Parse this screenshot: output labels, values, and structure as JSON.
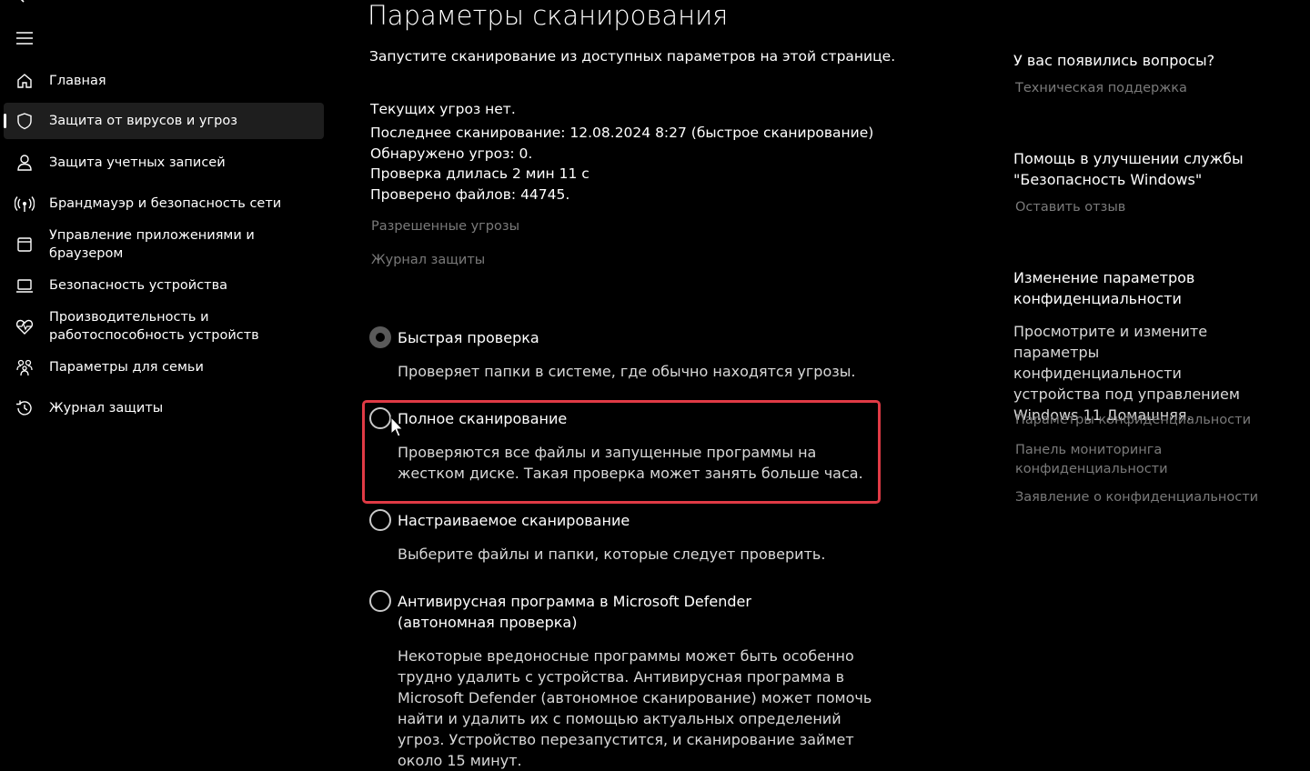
{
  "sidebar": {
    "items": [
      {
        "label": "Главная",
        "icon": "home-icon"
      },
      {
        "label": "Защита от вирусов и угроз",
        "icon": "shield-icon",
        "active": true
      },
      {
        "label": "Защита учетных записей",
        "icon": "person-icon"
      },
      {
        "label": "Брандмауэр и безопасность сети",
        "icon": "wireless-icon"
      },
      {
        "label": "Управление приложениями и браузером",
        "icon": "app-window-icon"
      },
      {
        "label": "Безопасность устройства",
        "icon": "laptop-icon"
      },
      {
        "label": "Производительность и работоспособность устройств",
        "icon": "heart-pulse-icon"
      },
      {
        "label": "Параметры для семьи",
        "icon": "family-icon"
      },
      {
        "label": "Журнал защиты",
        "icon": "history-icon"
      }
    ]
  },
  "main": {
    "title": "Параметры сканирования",
    "subtitle": "Запустите сканирование из доступных параметров на этой странице.",
    "status": [
      "Текущих угроз нет.",
      "Последнее сканирование: 12.08.2024 8:27 (быстрое сканирование)",
      "Обнаружено угроз: 0.",
      "Проверка длилась 2 мин 11 с",
      "Проверено файлов: 44745."
    ],
    "links": {
      "allowed_threats": "Разрешенные угрозы",
      "protection_history": "Журнал защиты"
    },
    "options": [
      {
        "title": "Быстрая проверка",
        "desc": "Проверяет папки в системе, где обычно находятся угрозы.",
        "selected": true
      },
      {
        "title": "Полное сканирование",
        "desc": "Проверяются все файлы и запущенные программы на жестком диске. Такая проверка может занять больше часа.",
        "selected": false
      },
      {
        "title": "Настраиваемое сканирование",
        "desc": "Выберите файлы и папки, которые следует проверить.",
        "selected": false
      },
      {
        "title": "Антивирусная программа в Microsoft Defender (автономная проверка)",
        "desc": "Некоторые вредоносные программы может быть особенно трудно удалить с устройства. Антивирусная программа в Microsoft Defender (автономное сканирование) может помочь найти и удалить их с помощью актуальных определений угроз. Устройство перезапустится, и сканирование займет около 15 минут.",
        "selected": false
      }
    ]
  },
  "right": {
    "questions_heading": "У вас появились вопросы?",
    "support_link": "Техническая поддержка",
    "improve_heading": "Помощь в улучшении службы \"Безопасность Windows\"",
    "feedback_link": "Оставить отзыв",
    "privacy_heading": "Изменение параметров конфиденциальности",
    "privacy_text": "Просмотрите и измените параметры конфиденциальности устройства под управлением Windows 11 Домашняя.",
    "privacy_links": [
      "Параметры конфиденциальности",
      "Панель мониторинга конфиденциальности",
      "Заявление о конфиденциальности"
    ]
  },
  "colors": {
    "background": "#000000",
    "highlight": "#e03a45",
    "muted_link": "#7a7a7a"
  }
}
